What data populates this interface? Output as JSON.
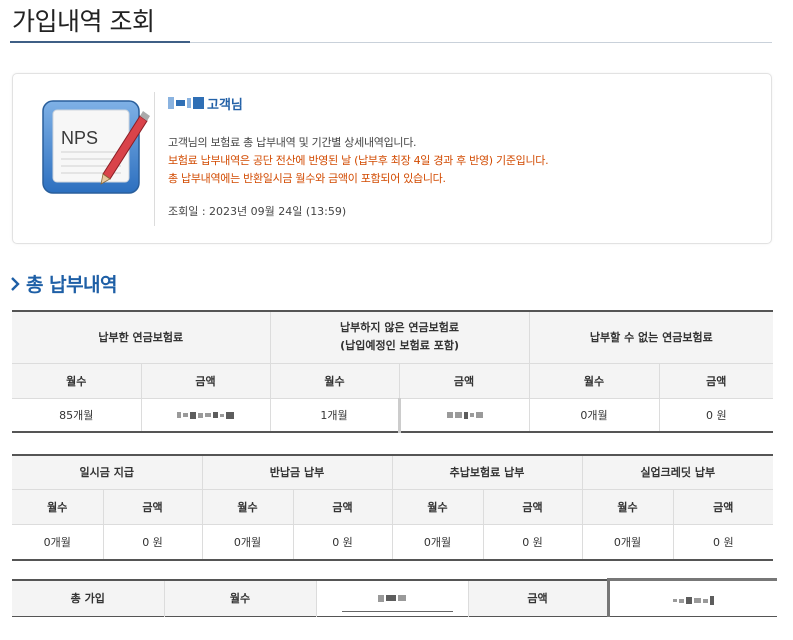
{
  "page": {
    "title": "가입내역 조회"
  },
  "info": {
    "icon_text": "NPS",
    "customer_label": "고객님",
    "lines": [
      "고객님의 보험료 총 납부내역 및 기간별 상세내역입니다.",
      "보험료 납부내역은 공단 전산에 반영된 날 (납부후 최장 4일 경과 후 반영) 기준입니다.",
      "총 납부내역에는 반환일시금 월수와 금액이 포함되어 있습니다."
    ],
    "query_date": "조회일 : 2023년 09월 24일 (13:59)"
  },
  "section": {
    "title": "총 납부내역"
  },
  "table1": {
    "groups": [
      "납부한 연금보험료",
      "납부하지 않은 연금보험료\n(납입예정인 보험료 포함)",
      "납부할 수 없는 연금보험료"
    ],
    "sub_headers": [
      "월수",
      "금액",
      "월수",
      "금액",
      "월수",
      "금액"
    ],
    "row": [
      "85개월",
      "",
      "1개월",
      "",
      "0개월",
      "0 원"
    ]
  },
  "table2": {
    "groups": [
      "일시금 지급",
      "반납금 납부",
      "추납보험료 납부",
      "실업크레딧 납부"
    ],
    "sub_headers": [
      "월수",
      "금액",
      "월수",
      "금액",
      "월수",
      "금액",
      "월수",
      "금액"
    ],
    "row": [
      "0개월",
      "0 원",
      "0개월",
      "0 원",
      "0개월",
      "0 원",
      "0개월",
      "0 원"
    ]
  },
  "table3": {
    "label": "총 가입",
    "months_label": "월수",
    "amount_label": "금액"
  },
  "colors": {
    "accent": "#1e5fa6",
    "notice": "#d24a00",
    "rule": "#555555"
  }
}
